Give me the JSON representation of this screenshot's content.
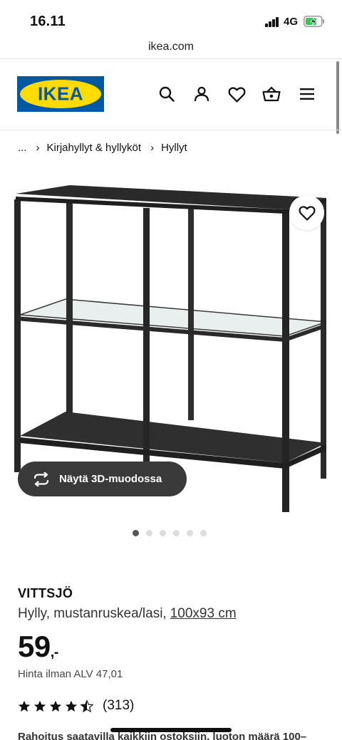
{
  "status_bar": {
    "time": "16.11",
    "network": "4G",
    "battery_icon": "battery-charging-icon"
  },
  "browser": {
    "url": "ikea.com"
  },
  "header": {
    "logo_text": "IKEA",
    "icons": [
      "search-icon",
      "account-icon",
      "heart-icon",
      "cart-icon",
      "menu-icon"
    ],
    "brand_blue": "#0058A3",
    "brand_yellow": "#FFDB00"
  },
  "breadcrumb": {
    "items": [
      "...",
      "Kirjahyllyt & hyllyköt",
      "Hyllyt"
    ],
    "separator": "›"
  },
  "gallery": {
    "view_3d_label": "Näytä 3D-muodossa",
    "image_count": 6,
    "active_index": 0
  },
  "product": {
    "name": "VITTSJÖ",
    "description": "Hylly, mustanruskea/lasi,",
    "size": "100x93 cm",
    "price": "59",
    "price_suffix": ",-",
    "price_without_vat": "Hinta ilman ALV 47,01",
    "rating_value": 4.5,
    "review_count": "(313)"
  },
  "promo": {
    "text": "Rahoitus saatavilla kaikkiin ostoksiin, luoton määrä 100–"
  }
}
